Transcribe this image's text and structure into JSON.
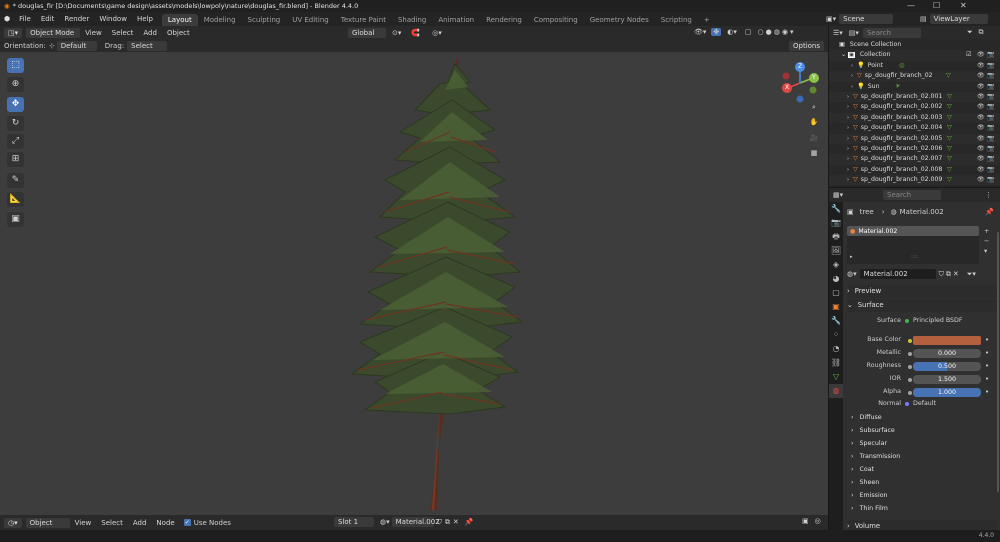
{
  "window": {
    "title": "* douglas_fir [D:\\Documents\\game design\\assets\\models\\lowpoly\\nature\\douglas_fir.blend] - Blender 4.4.0"
  },
  "menu": [
    "File",
    "Edit",
    "Render",
    "Window",
    "Help"
  ],
  "workspaces": [
    "Layout",
    "Modeling",
    "Sculpting",
    "UV Editing",
    "Texture Paint",
    "Shading",
    "Animation",
    "Rendering",
    "Compositing",
    "Geometry Nodes",
    "Scripting"
  ],
  "scene": {
    "label": "Scene",
    "view_layer": "ViewLayer"
  },
  "viewport": {
    "mode": "Object Mode",
    "menus": [
      "View",
      "Select",
      "Add",
      "Object"
    ],
    "transform_orientation": "Global",
    "orientation_label": "Orientation:",
    "orientation_value": "Default",
    "drag_label": "Drag:",
    "drag_value": "Select Box",
    "options_label": "Options"
  },
  "gizmo": {
    "x": "X",
    "y": "Y",
    "z": "Z"
  },
  "outliner": {
    "search_placeholder": "Search",
    "scene_collection": "Scene Collection",
    "collection": "Collection",
    "items": [
      "Point",
      "sp_dougfir_branch_02",
      "Sun",
      "sp_dougfir_branch_02.001",
      "sp_dougfir_branch_02.002",
      "sp_dougfir_branch_02.003",
      "sp_dougfir_branch_02.004",
      "sp_dougfir_branch_02.005",
      "sp_dougfir_branch_02.006",
      "sp_dougfir_branch_02.007",
      "sp_dougfir_branch_02.008",
      "sp_dougfir_branch_02.009"
    ]
  },
  "properties": {
    "search_placeholder": "Search",
    "breadcrumb_object": "tree",
    "breadcrumb_material": "Material.002",
    "slot_material": "Material.002",
    "material_name": "Material.002",
    "preview": "Preview",
    "surface": "Surface",
    "surface_label": "Surface",
    "surface_value": "Principled BSDF",
    "fields": [
      {
        "label": "Base Color",
        "value": "",
        "fill": 1.0
      },
      {
        "label": "Metallic",
        "value": "0.000",
        "fill": 0.0
      },
      {
        "label": "Roughness",
        "value": "0.500",
        "fill": 0.5
      },
      {
        "label": "IOR",
        "value": "1.500",
        "fill": 0.0
      },
      {
        "label": "Alpha",
        "value": "1.000",
        "fill": 1.0
      }
    ],
    "normal_label": "Normal",
    "normal_value": "Default",
    "subpanels": [
      "Diffuse",
      "Subsurface",
      "Specular",
      "Transmission",
      "Coat",
      "Sheen",
      "Emission",
      "Thin Film"
    ],
    "volume": "Volume",
    "base_color_hex": "#b4603f"
  },
  "shader_bar": {
    "editor": "Object",
    "menus": [
      "View",
      "Select",
      "Add",
      "Node"
    ],
    "use_nodes": "Use Nodes",
    "slot": "Slot 1",
    "material": "Material.002"
  },
  "status": {
    "version": "4.4.0"
  },
  "colors": {
    "accent": "#4772b3",
    "orange": "#e6823c",
    "green": "#6bbf3a"
  }
}
